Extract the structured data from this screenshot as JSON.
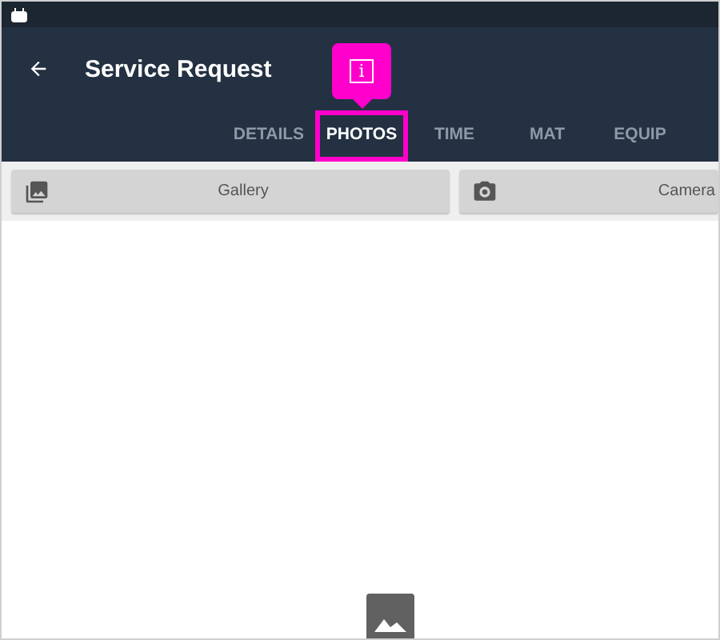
{
  "app_bar": {
    "title": "Service Request"
  },
  "tabs": [
    {
      "label": "DETAILS",
      "selected": false,
      "highlighted": false
    },
    {
      "label": "PHOTOS",
      "selected": true,
      "highlighted": true
    },
    {
      "label": "TIME",
      "selected": false,
      "highlighted": false
    },
    {
      "label": "MAT",
      "selected": false,
      "highlighted": false
    },
    {
      "label": "EQUIP",
      "selected": false,
      "highlighted": false
    }
  ],
  "annotation": {
    "marker": "i"
  },
  "buttons": [
    {
      "label": "Gallery",
      "kind": "gallery"
    },
    {
      "label": "Camera",
      "kind": "camera"
    }
  ]
}
